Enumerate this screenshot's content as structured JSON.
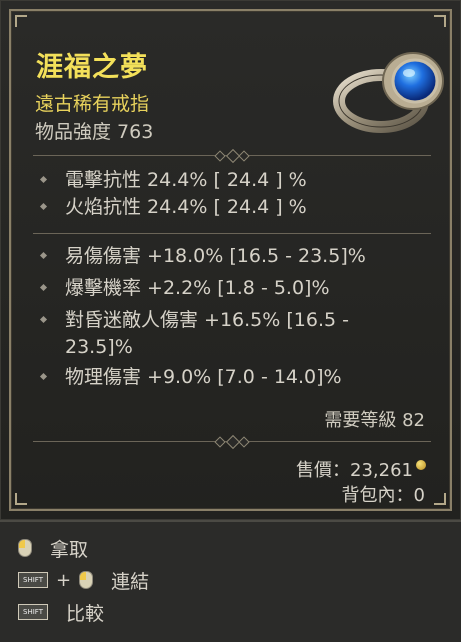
{
  "item": {
    "name": "涯福之夢",
    "rarity": "遠古稀有戒指",
    "power": "物品強度 763"
  },
  "implicits": [
    "電擊抗性 24.4%  [ 24.4 ] %",
    "火焰抗性 24.4%  [ 24.4 ] %"
  ],
  "affixes": [
    "易傷傷害 +18.0% [16.5 - 23.5]%",
    "爆擊機率 +2.2% [1.8 - 5.0]%",
    "對昏迷敵人傷害 +16.5% [16.5 - 23.5]%",
    "物理傷害 +9.0% [7.0 - 14.0]%"
  ],
  "requirement": "需要等級 82",
  "sell_price": "售價：23,261",
  "in_bag": "背包內：0",
  "actions": {
    "take": "拿取",
    "link": "連結",
    "compare": "比較",
    "shift_key": "SHIFT",
    "plus": "+"
  },
  "colors": {
    "name": "#f3e05a",
    "rarity": "#e8d25c",
    "text": "#d6d2c8"
  },
  "icons": {
    "ring": "ring-icon",
    "mouse": "mouse-left-icon",
    "shift": "shift-key-icon",
    "gold": "gold-coin-icon"
  }
}
